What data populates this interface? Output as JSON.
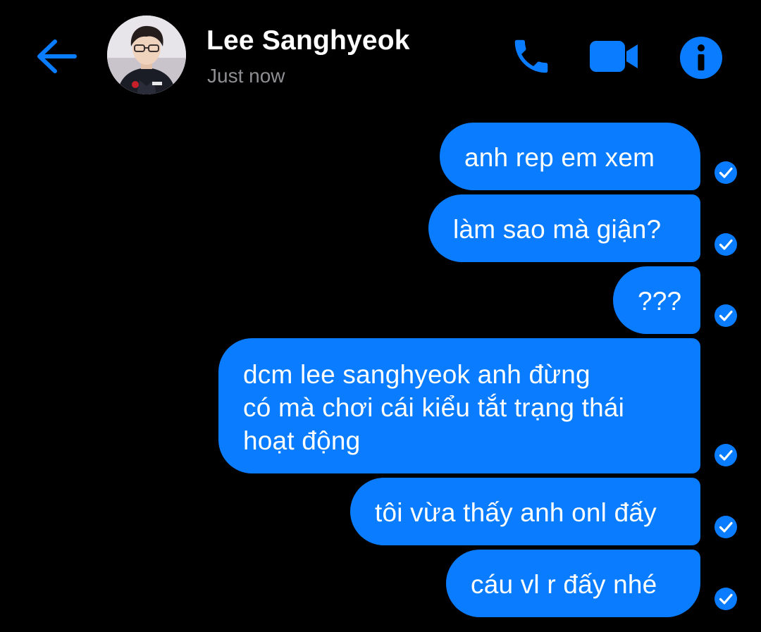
{
  "header": {
    "contact_name": "Lee Sanghyeok",
    "status": "Just now",
    "accent_color": "#0a7cff",
    "icons": {
      "back": "arrow-left-icon",
      "call": "phone-icon",
      "video": "video-camera-icon",
      "info": "info-icon"
    }
  },
  "messages": [
    {
      "lines": [
        "anh rep em xem"
      ],
      "status": "seen-check"
    },
    {
      "lines": [
        "làm sao mà giận?"
      ],
      "status": "seen-check"
    },
    {
      "lines": [
        "???"
      ],
      "status": "seen-check"
    },
    {
      "lines": [
        "dcm lee sanghyeok anh đừng",
        "có mà chơi cái kiểu tắt trạng thái",
        "hoạt động"
      ],
      "status": "seen-check"
    },
    {
      "lines": [
        "tôi vừa thấy anh onl đấy"
      ],
      "status": "seen-check"
    },
    {
      "lines": [
        "cáu vl r đấy nhé"
      ],
      "status": "seen-check"
    }
  ]
}
